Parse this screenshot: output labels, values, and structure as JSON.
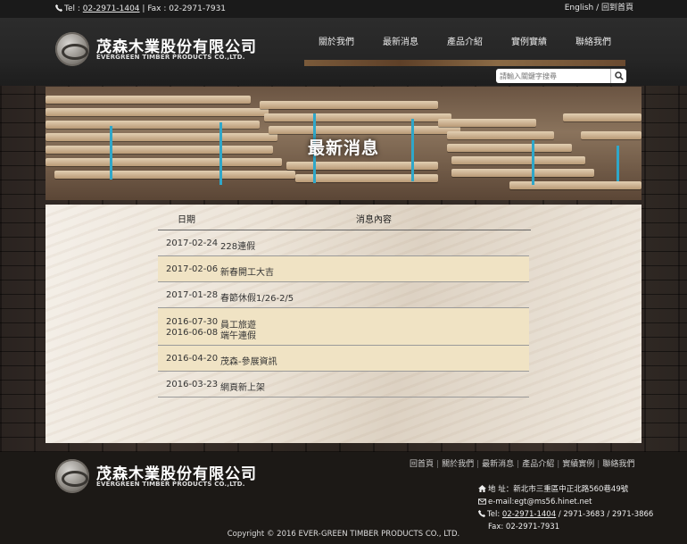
{
  "topbar": {
    "tel_label": "Tel :",
    "tel": "02-2971-1404",
    "fax_text": "| Fax : 02-2971-7931",
    "lang": "English / 回到首頁"
  },
  "brand": {
    "name_cn": "茂森木業股份有限公司",
    "name_en": "EVERGREEN TIMBER PRODUCTS CO.,LTD."
  },
  "nav": [
    "關於我們",
    "最新消息",
    "產品介紹",
    "實例實績",
    "聯絡我們"
  ],
  "search": {
    "placeholder": "請輸入關鍵字搜尋"
  },
  "banner": {
    "title": "最新消息"
  },
  "news": {
    "col_date": "日期",
    "col_title": "消息內容",
    "rows": [
      {
        "date": "2017-02-24",
        "title": "228連假"
      },
      {
        "date": "2017-02-06",
        "title": "新春開工大吉"
      },
      {
        "date": "2017-01-28",
        "title": "春節休假1/26-2/5"
      },
      {
        "date": "2016-07-30",
        "title": "員工旅遊"
      },
      {
        "date": "2016-06-08",
        "title": "端午連假"
      },
      {
        "date": "2016-04-20",
        "title": "茂森-參展資訊"
      },
      {
        "date": "2016-03-23",
        "title": "網頁新上架"
      }
    ]
  },
  "footer": {
    "nav": [
      "回首頁",
      "關於我們",
      "最新消息",
      "產品介紹",
      "實績實例",
      "聯絡我們"
    ],
    "address": "地 址：新北市三重區中正北路560巷49號",
    "email": "e-mail:egt@ms56.hinet.net",
    "tel_prefix": "Tel:",
    "tel_main": "02-2971-1404",
    "tel_rest": "/ 2971-3683 / 2971-3866",
    "fax": "Fax: 02-2971-7931",
    "copyright": "Copyright © 2016 EVER-GREEN TIMBER PRODUCTS CO., LTD."
  },
  "colors": {
    "highlight_row": "#f0e3c4",
    "accent_wood": "#7a5a3a",
    "tape": "#2fa7c9"
  }
}
